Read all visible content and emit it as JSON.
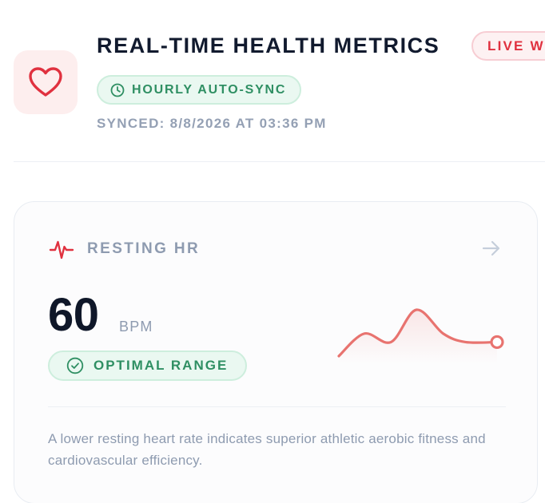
{
  "header": {
    "title": "REAL-TIME HEALTH METRICS",
    "live_badge": "LIVE W",
    "sync_chip": "HOURLY AUTO-SYNC",
    "synced": "SYNCED: 8/8/2026 AT 03:36 PM",
    "icon": "heart-icon"
  },
  "card": {
    "label": "RESTING HR",
    "value": "60",
    "unit": "BPM",
    "status": "OPTIMAL RANGE",
    "description": "A lower resting heart rate indicates superior athletic aerobic fitness and cardiovascular efficiency.",
    "icons": {
      "metric": "heartbeat-icon",
      "open": "arrow-right-icon",
      "status": "check-circle-icon",
      "sync": "clock-icon"
    },
    "sparkline": [
      52,
      68,
      62,
      85,
      68,
      62,
      62
    ]
  },
  "colors": {
    "accent_red": "#e0313f",
    "sparkline": "#e8736f",
    "success_green": "#2f8f63",
    "title": "#111a2e",
    "muted": "#8e9bb0"
  }
}
